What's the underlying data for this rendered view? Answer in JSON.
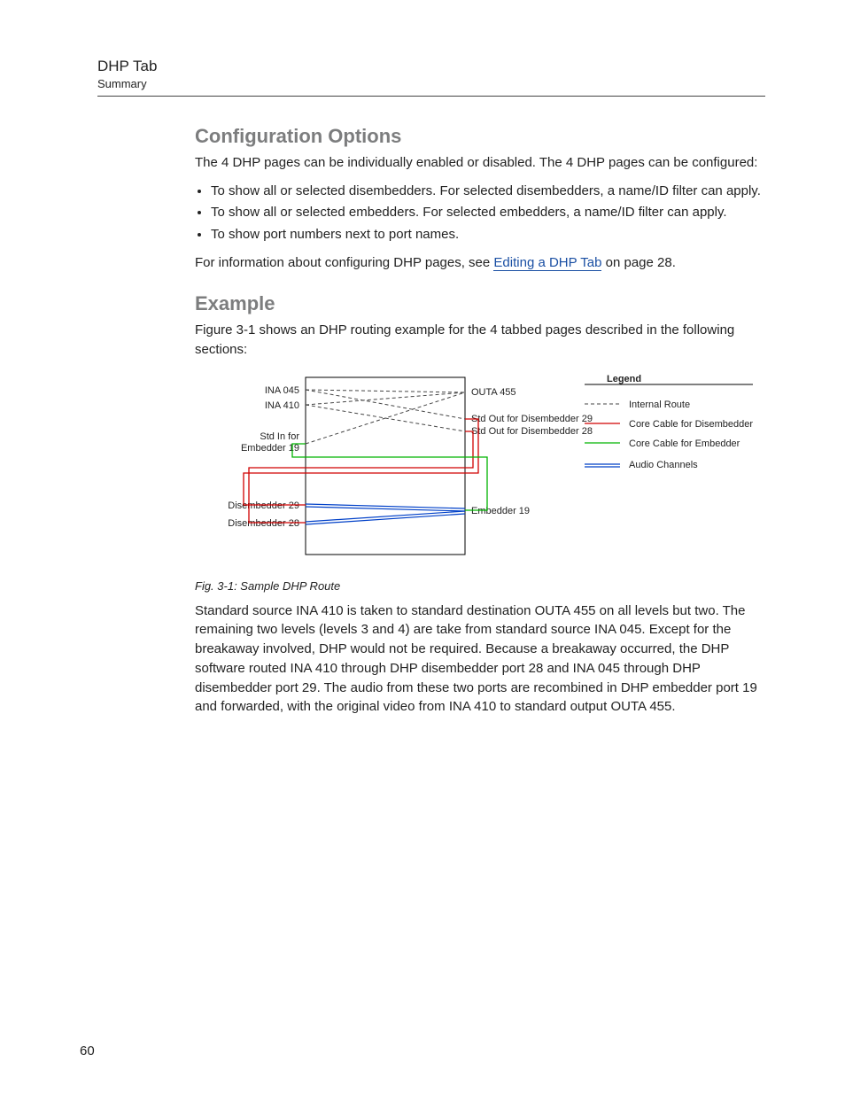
{
  "header": {
    "title": "DHP Tab",
    "subtitle": "Summary"
  },
  "section1": {
    "heading": "Configuration Options",
    "intro": "The 4 DHP pages can be individually enabled or disabled. The 4 DHP pages can be configured:",
    "bullets": [
      "To show all or selected disembedders. For selected disembedders, a name/ID filter can apply.",
      "To show all or selected embedders. For selected embedders, a name/ID filter can apply.",
      "To show port numbers next to port names."
    ],
    "after_pre": "For information about configuring DHP pages, see ",
    "link": "Editing a DHP Tab",
    "after_post": " on page 28."
  },
  "section2": {
    "heading": "Example",
    "intro": "Figure 3-1 shows an DHP routing example for the 4 tabbed pages described in the following sections:"
  },
  "figure": {
    "caption": "Fig. 3-1: Sample DHP Route",
    "labels": {
      "ina045": "INA 045",
      "ina410": "INA 410",
      "stdin_l1": "Std In for",
      "stdin_l2": "Embedder 19",
      "dis29": "Disembedder 29",
      "dis28": "Disembedder 28",
      "outa455": "OUTA 455",
      "stdout29": "Std Out for Disembedder 29",
      "stdout28": "Std Out for Disembedder 28",
      "emb19": "Embedder 19"
    },
    "legend": {
      "title": "Legend",
      "internal": "Internal Route",
      "core_dis": "Core Cable for Disembedder",
      "core_emb": "Core Cable for Embedder",
      "audio": "Audio Channels"
    }
  },
  "para": "Standard source INA 410 is taken to standard destination OUTA 455 on all levels but two. The remaining two levels (levels 3 and 4) are take from standard source INA 045. Except for the breakaway involved, DHP would not be required. Because a breakaway occurred, the DHP software routed INA 410 through DHP disembedder port 28 and INA 045 through DHP disembedder port 29. The audio from these two ports are recombined in DHP embedder port 19 and forwarded, with the original video from INA 410 to standard output OUTA 455.",
  "page_number": "60"
}
